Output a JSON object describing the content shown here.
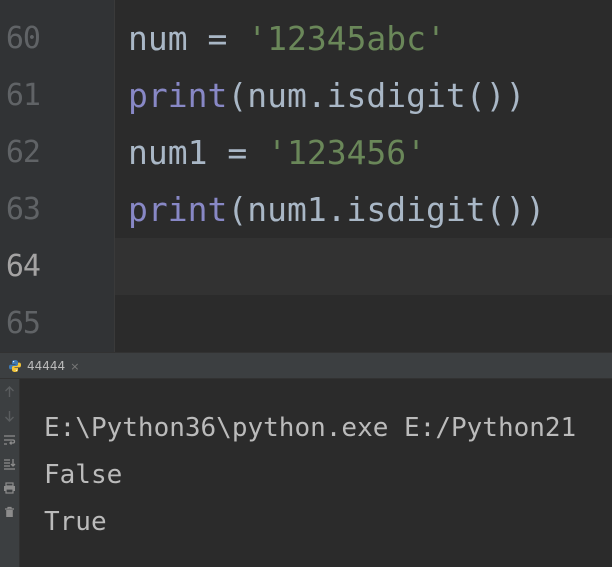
{
  "gutter": {
    "line_numbers": [
      "60",
      "61",
      "62",
      "63",
      "64",
      "65"
    ]
  },
  "code": {
    "line60": {
      "var": "num",
      "op": " = ",
      "str": "'12345abc'"
    },
    "line61": {
      "kw": "print",
      "rest": "(num.isdigit())"
    },
    "line62": {
      "var": "num1",
      "op": " = ",
      "str": "'123456'"
    },
    "line63": {
      "kw": "print",
      "rest": "(num1.isdigit())"
    }
  },
  "run_panel": {
    "tab_label": "44444",
    "tab_close": "×",
    "icon": "python-icon",
    "output": [
      "E:\\Python36\\python.exe E:/Python21",
      "False",
      "True"
    ]
  },
  "colors": {
    "background": "#2b2b2b",
    "keyword": "#8888c6",
    "string": "#6a8759",
    "default_text": "#a9b7c6"
  }
}
